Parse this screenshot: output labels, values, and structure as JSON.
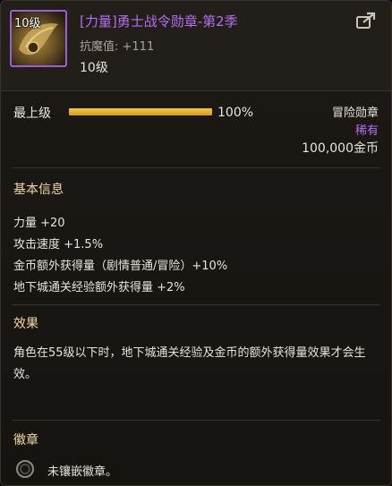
{
  "item": {
    "icon_level": "10级",
    "name": "[力量]勇士战令勋章-第2季",
    "resist": "抗魔值: +111",
    "level": "10级",
    "rarity_color": "#b46ef0"
  },
  "progress": {
    "label": "最上级",
    "value": 1.0,
    "value_text": "100%"
  },
  "meta": {
    "type": "冒险勋章",
    "rarity": "稀有",
    "price": "100,000金币"
  },
  "basic_info": {
    "title": "基本信息",
    "stats": [
      "力量 +20",
      "攻击速度 +1.5%",
      "金币额外获得量（剧情普通/冒险）+10%",
      "地下城通关经验额外获得量 +2%"
    ]
  },
  "effect": {
    "title": "效果",
    "text": "角色在55级以下时，地下城通关经验及金币的额外获得量效果才会生效。"
  },
  "emblem": {
    "title": "徽章",
    "empty_text": "未镶嵌徽章。"
  },
  "icons": {
    "item": "medal-icon",
    "share": "share-icon",
    "emblem_slot": "empty-emblem-slot-icon"
  }
}
